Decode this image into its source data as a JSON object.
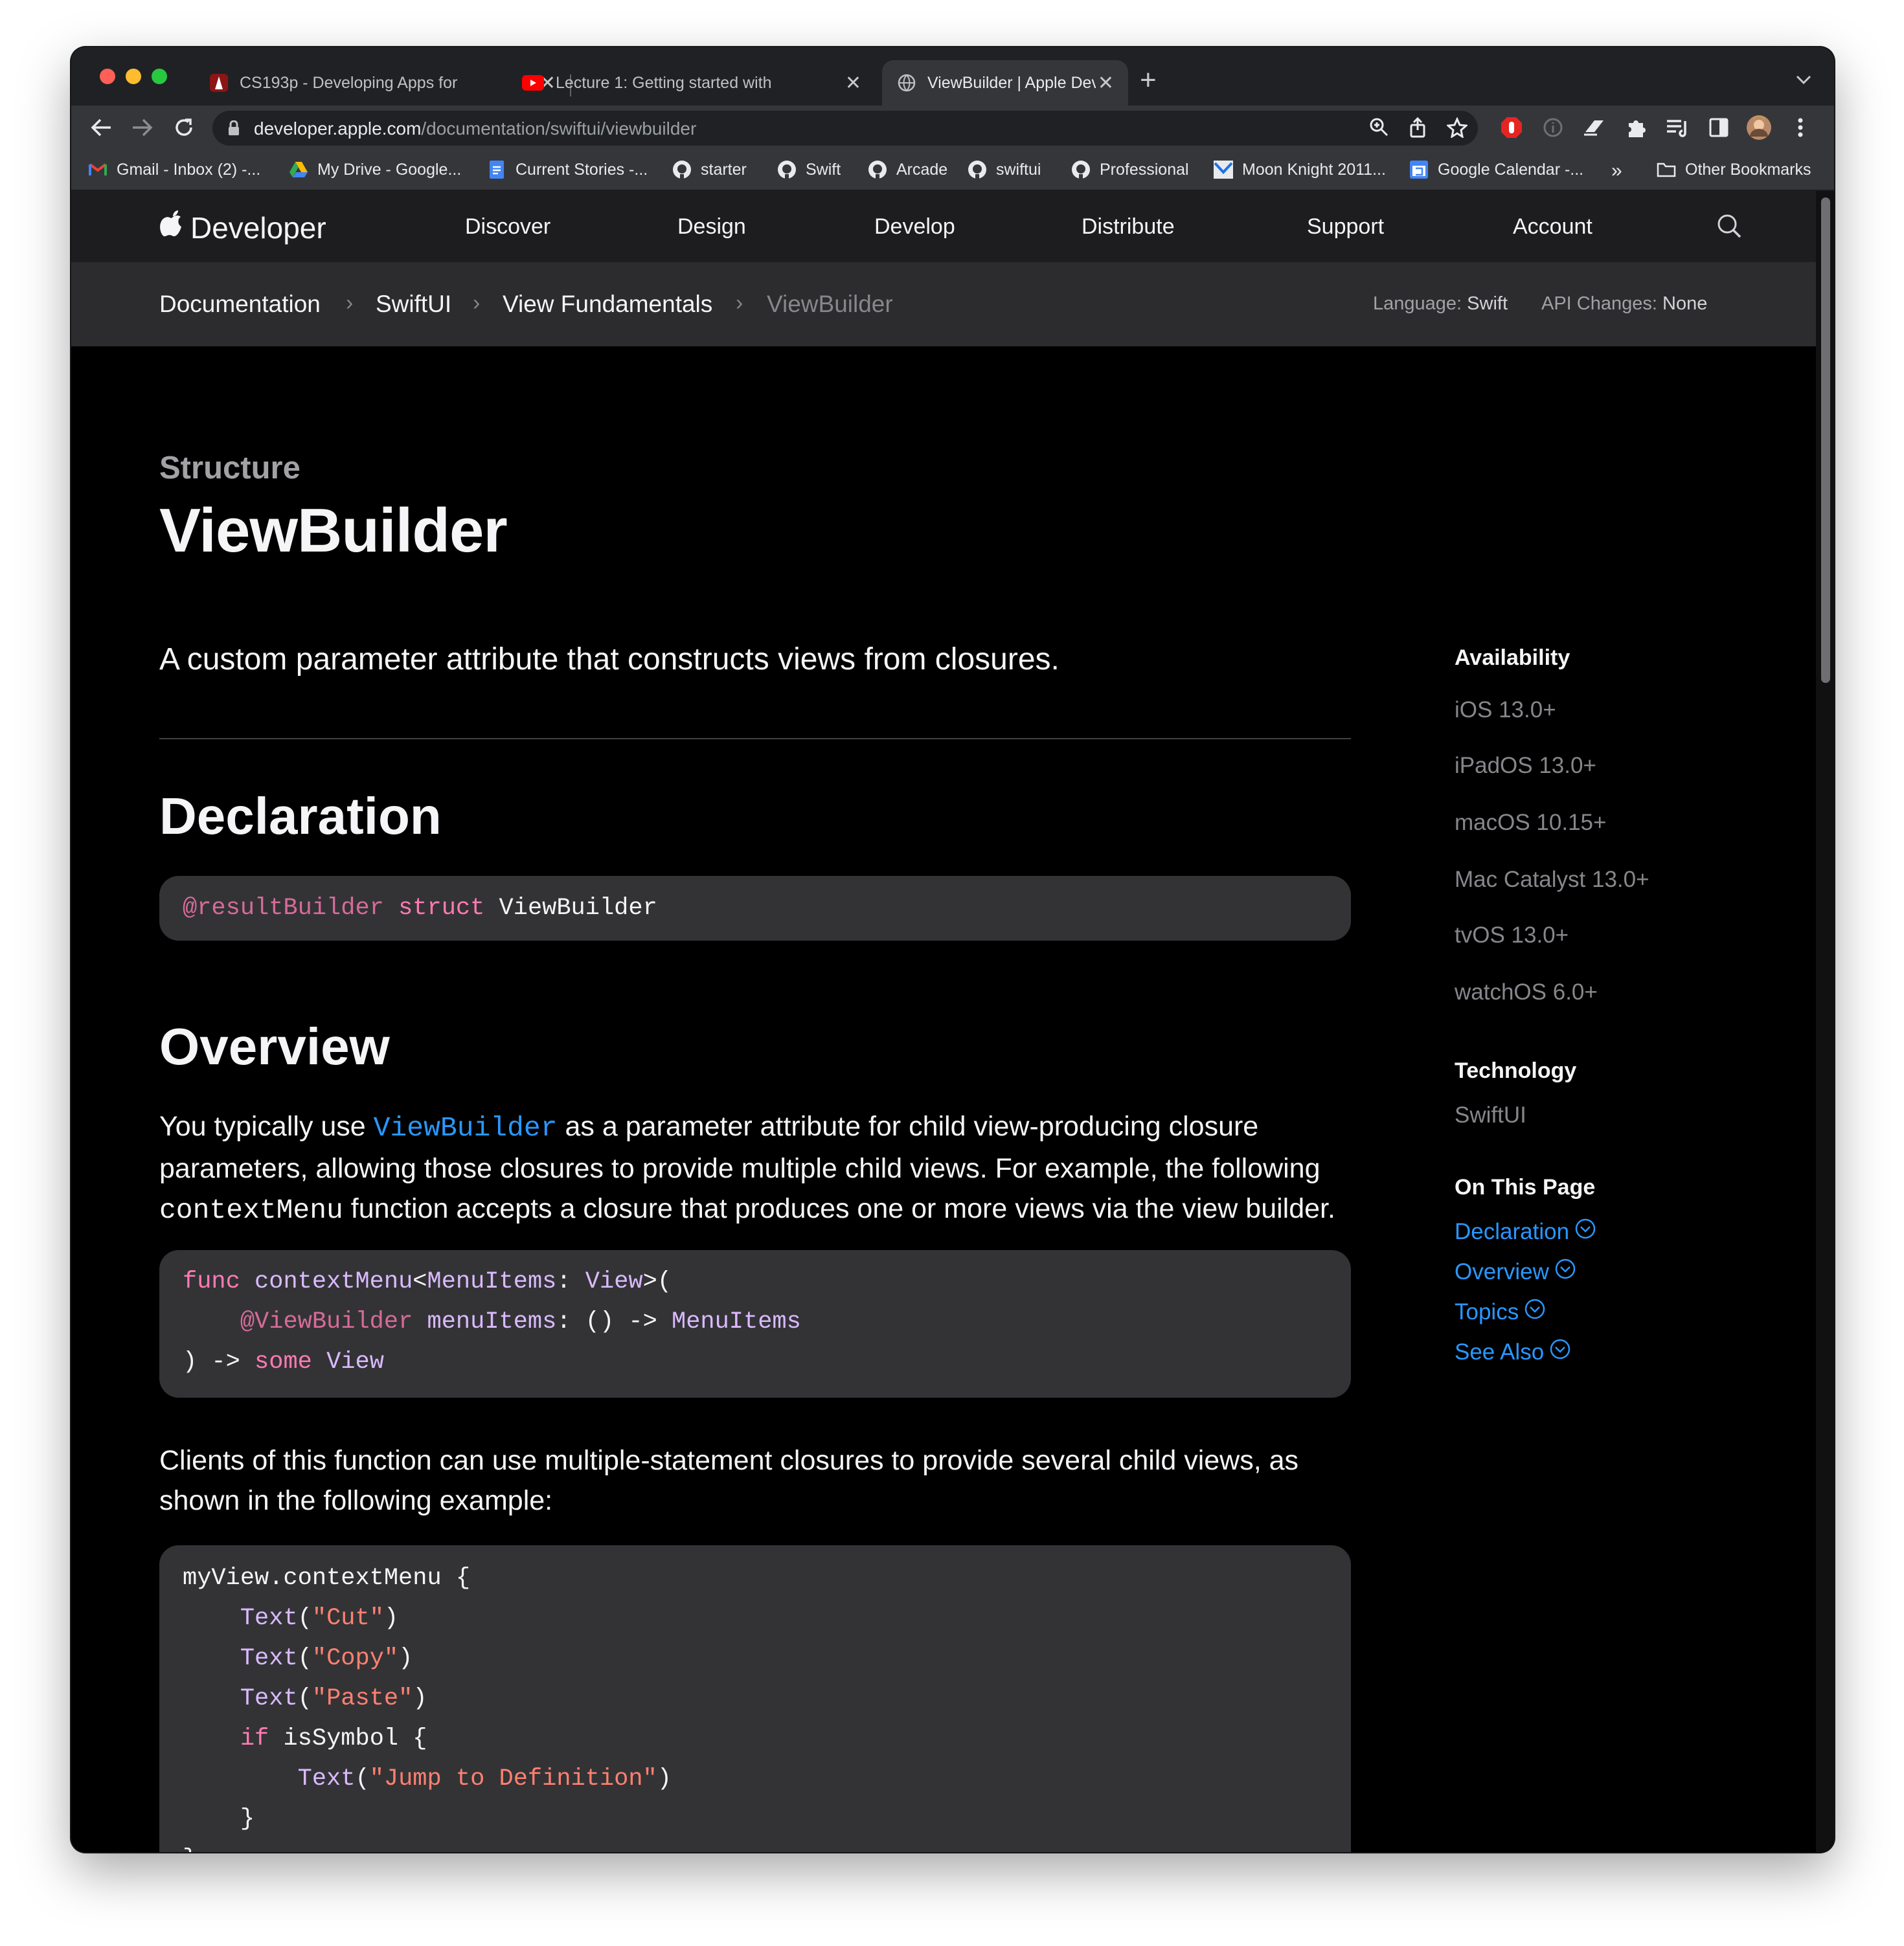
{
  "browser": {
    "tabs": [
      {
        "title": "CS193p - Developing Apps for",
        "active": false
      },
      {
        "title": "Lecture 1: Getting started with",
        "active": false
      },
      {
        "title": "ViewBuilder | Apple Developer",
        "active": true
      }
    ],
    "new_tab_symbol": "+",
    "url_domain": "developer.apple.com",
    "url_path": "/documentation/swiftui/viewbuilder",
    "bookmarks": [
      "Gmail - Inbox (2) -...",
      "My Drive - Google...",
      "Current Stories -...",
      "starter",
      "Swift",
      "Arcade",
      "swiftui",
      "Professional",
      "Moon Knight 2011...",
      "Google Calendar -..."
    ],
    "bookmarks_overflow": "»",
    "other_bookmarks": "Other Bookmarks"
  },
  "globalnav": {
    "brand": "Developer",
    "items": [
      "Discover",
      "Design",
      "Develop",
      "Distribute",
      "Support",
      "Account"
    ]
  },
  "breadcrumb": [
    "Documentation",
    "SwiftUI",
    "View Fundamentals",
    "ViewBuilder"
  ],
  "localnav_meta": {
    "language_label": "Language:",
    "language_value": "Swift",
    "api_label": "API Changes:",
    "api_value": "None"
  },
  "doc": {
    "eyebrow": "Structure",
    "title": "ViewBuilder",
    "abstract": "A custom parameter attribute that constructs views from closures.",
    "declaration_heading": "Declaration",
    "declaration_attr": "@resultBuilder",
    "declaration_kw": "struct",
    "declaration_name": "ViewBuilder",
    "overview_heading": "Overview",
    "overview_p1_a": "You typically use ",
    "overview_p1_link": "ViewBuilder",
    "overview_p1_b": " as a parameter attribute for child view-producing closure parameters, allowing those closures to provide multiple child views. For example, the following ",
    "overview_p1_code": "contextMenu",
    "overview_p1_c": " function accepts a closure that produces one or more views via the view builder.",
    "code1": {
      "l1_kw": "func",
      "l1_name": "contextMenu",
      "l1_lt": "<",
      "l1_generic": "MenuItems",
      "l1_colon": ": ",
      "l1_type": "View",
      "l1_end": ">(",
      "l2_attr": "@ViewBuilder",
      "l2_param": "menuItems",
      "l2_mid": ": () -> ",
      "l2_type": "MenuItems",
      "l3_start": ") -> ",
      "l3_kw": "some",
      "l3_type": "View"
    },
    "overview_p2": "Clients of this function can use multiple-statement closures to provide several child views, as shown in the following example:",
    "code2": {
      "l1": "myView.contextMenu {",
      "text_fn": "Text",
      "s1": "\"Cut\"",
      "s2": "\"Copy\"",
      "s3": "\"Paste\"",
      "if_kw": "if",
      "if_cond": "isSymbol {",
      "s4": "\"Jump to Definition\"",
      "close_inner": "}",
      "close_outer": "}"
    }
  },
  "sidebar": {
    "availability_heading": "Availability",
    "platforms": [
      "iOS 13.0+",
      "iPadOS 13.0+",
      "macOS 10.15+",
      "Mac Catalyst 13.0+",
      "tvOS 13.0+",
      "watchOS 6.0+"
    ],
    "technology_heading": "Technology",
    "technology": "SwiftUI",
    "on_this_page_heading": "On This Page",
    "on_this_page": [
      "Declaration",
      "Overview",
      "Topics",
      "See Also"
    ]
  }
}
